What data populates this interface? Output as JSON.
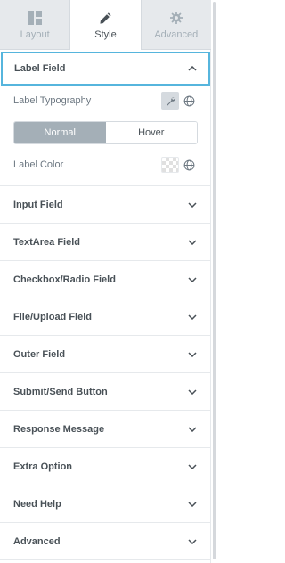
{
  "tabs": [
    {
      "label": "Layout",
      "icon": "layout-icon",
      "active": false
    },
    {
      "label": "Style",
      "icon": "pencil-icon",
      "active": true
    },
    {
      "label": "Advanced",
      "icon": "gear-icon",
      "active": false
    }
  ],
  "label_field": {
    "title": "Label Field",
    "expanded": true,
    "typography_label": "Label Typography",
    "states": [
      "Normal",
      "Hover"
    ],
    "selected_state": "Normal",
    "color_label": "Label Color"
  },
  "sections": [
    "Input Field",
    "TextArea Field",
    "Checkbox/Radio Field",
    "File/Upload Field",
    "Outer Field",
    "Submit/Send Button",
    "Response Message",
    "Extra Option",
    "Need Help",
    "Advanced"
  ],
  "colors": {
    "accent": "#56b5dd",
    "toggle_active": "#a4afb7",
    "text": "#495157"
  }
}
